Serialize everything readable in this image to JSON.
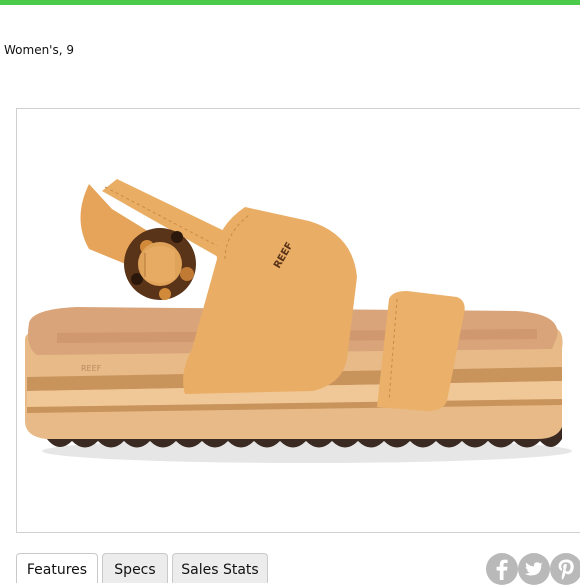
{
  "header": {
    "accent_color": "#4ccb4a"
  },
  "product": {
    "size_label": "Women's, 9",
    "brand_mark": "REEF",
    "image_alt": "Tan leather two-strap platform sandal with tortoiseshell buckle"
  },
  "tabs": [
    {
      "label": "Features",
      "active": true
    },
    {
      "label": "Specs",
      "active": false
    },
    {
      "label": "Sales Stats",
      "active": false
    }
  ],
  "share_icons": [
    "facebook-icon",
    "twitter-icon",
    "pinterest-icon"
  ]
}
